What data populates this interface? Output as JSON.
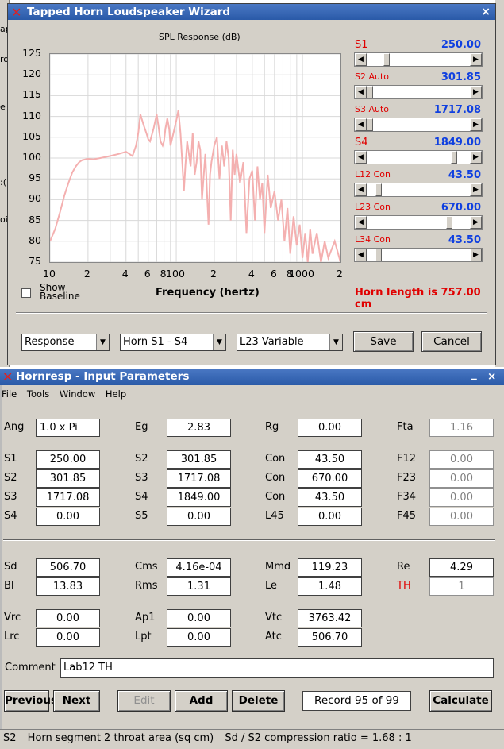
{
  "background": {
    "fragments": [
      "ap",
      "ro",
      "e",
      ":(",
      "oi"
    ]
  },
  "wizard": {
    "title": "Tapped Horn Loudspeaker Wizard",
    "close_icon": "close-icon",
    "chart_title": "SPL Response (dB)",
    "show_baseline_line1": "Show",
    "show_baseline_line2": "Baseline",
    "sliders": [
      {
        "label": "S1",
        "value": "250.00",
        "level": 0.17
      },
      {
        "label": "S2 Auto",
        "value": "301.85",
        "level": 0.0
      },
      {
        "label": "S3 Auto",
        "value": "1717.08",
        "level": 0.0
      },
      {
        "label": "S4",
        "value": "1849.00",
        "level": 0.87
      },
      {
        "label": "L12 Con",
        "value": "43.50",
        "level": 0.09
      },
      {
        "label": "L23 Con",
        "value": "670.00",
        "level": 0.82
      },
      {
        "label": "L34 Con",
        "value": "43.50",
        "level": 0.09
      }
    ],
    "horn_length": "Horn length is 757.00 cm",
    "dropdowns": [
      "Response",
      "Horn S1 - S4",
      "L23 Variable"
    ],
    "save_label": "Save",
    "cancel_label": "Cancel"
  },
  "chart_data": {
    "type": "line",
    "title": "SPL Response (dB)",
    "xlabel": "Frequency (hertz)",
    "ylabel": "",
    "xscale": "log",
    "xlim": [
      10,
      2000
    ],
    "ylim": [
      75,
      125
    ],
    "y_ticks": [
      "125",
      "120",
      "115",
      "110",
      "105",
      "100",
      "95",
      "90",
      "85",
      "80",
      "75"
    ],
    "x_ticks": [
      "10",
      "2",
      "4",
      "6",
      "8",
      "100",
      "2",
      "4",
      "6",
      "8",
      "1000",
      "2"
    ],
    "grid": true,
    "series_color": "#f4b0b0",
    "series": [
      {
        "name": "",
        "x": [
          10,
          11,
          12,
          13,
          14,
          15,
          16,
          17,
          18,
          20,
          22,
          25,
          30,
          35,
          40,
          45,
          48,
          50,
          52,
          55,
          58,
          60,
          62,
          66,
          70,
          72,
          75,
          78,
          80,
          82,
          85,
          88,
          90,
          95,
          100,
          104,
          108,
          112,
          115,
          118,
          122,
          126,
          130,
          135,
          140,
          145,
          150,
          155,
          160,
          165,
          170,
          175,
          180,
          185,
          190,
          200,
          210,
          220,
          230,
          240,
          250,
          260,
          270,
          280,
          290,
          300,
          320,
          340,
          360,
          380,
          400,
          420,
          440,
          460,
          480,
          500,
          530,
          560,
          600,
          640,
          680,
          720,
          760,
          800,
          850,
          900,
          950,
          1000,
          1050,
          1100,
          1150,
          1200,
          1300,
          1400,
          1500,
          1600,
          1800,
          2000
        ],
        "y": [
          80,
          83,
          87,
          91,
          94,
          96.5,
          98,
          99,
          99.5,
          99.8,
          99.7,
          100,
          100.5,
          101,
          101.5,
          100.5,
          103,
          106,
          110.5,
          108,
          106,
          104.5,
          104,
          107,
          110.5,
          108,
          104,
          103,
          104,
          107,
          109.5,
          107,
          103,
          106,
          109,
          111.5,
          106,
          98,
          92,
          98,
          104,
          101,
          98,
          106,
          96,
          99,
          104,
          102,
          90,
          96,
          101,
          92,
          84,
          96,
          99,
          103,
          105,
          95,
          103,
          98,
          104,
          100,
          85,
          102,
          96,
          101,
          94,
          99,
          82,
          95,
          97,
          85,
          98,
          90,
          94,
          82,
          96,
          88,
          92,
          85,
          90,
          80,
          88,
          77,
          86,
          79,
          84,
          76,
          82,
          75,
          83,
          77,
          82,
          75,
          80,
          76,
          80,
          75
        ]
      }
    ]
  },
  "hornresp": {
    "title": "Hornresp - Input Parameters",
    "minimize_icon": "minimize-icon",
    "close_icon": "close-icon",
    "menu": [
      "File",
      "Tools",
      "Window",
      "Help"
    ],
    "rows": [
      {
        "c1": [
          "Ang",
          "1.0 x Pi"
        ],
        "c2": [
          "Eg",
          "2.83"
        ],
        "c3": [
          "Rg",
          "0.00"
        ],
        "c4": [
          "Fta",
          "1.16"
        ]
      },
      {
        "c1": [
          "S1",
          "250.00"
        ],
        "c2": [
          "S2",
          "301.85"
        ],
        "c3": [
          "Con",
          "43.50"
        ],
        "c4": [
          "F12",
          "0.00"
        ]
      },
      {
        "c1": [
          "S2",
          "301.85"
        ],
        "c2": [
          "S3",
          "1717.08"
        ],
        "c3": [
          "Con",
          "670.00"
        ],
        "c4": [
          "F23",
          "0.00"
        ]
      },
      {
        "c1": [
          "S3",
          "1717.08"
        ],
        "c2": [
          "S4",
          "1849.00"
        ],
        "c3": [
          "Con",
          "43.50"
        ],
        "c4": [
          "F34",
          "0.00"
        ]
      },
      {
        "c1": [
          "S4",
          "0.00"
        ],
        "c2": [
          "S5",
          "0.00"
        ],
        "c3": [
          "L45",
          "0.00"
        ],
        "c4": [
          "F45",
          "0.00"
        ]
      },
      {
        "c1": [
          "Sd",
          "506.70"
        ],
        "c2": [
          "Cms",
          "4.16e-04"
        ],
        "c3": [
          "Mmd",
          "119.23"
        ],
        "c4": [
          "Re",
          "4.29"
        ]
      },
      {
        "c1": [
          "Bl",
          "13.83"
        ],
        "c2": [
          "Rms",
          "1.31"
        ],
        "c3": [
          "Le",
          "1.48"
        ],
        "c4": [
          "TH",
          "1"
        ]
      },
      {
        "c1": [
          "Vrc",
          "0.00"
        ],
        "c2": [
          "Ap1",
          "0.00"
        ],
        "c3": [
          "Vtc",
          "3763.42"
        ],
        "c4": [
          "",
          ""
        ]
      },
      {
        "c1": [
          "Lrc",
          "0.00"
        ],
        "c2": [
          "Lpt",
          "0.00"
        ],
        "c3": [
          "Atc",
          "506.70"
        ],
        "c4": [
          "",
          ""
        ]
      }
    ],
    "comment_label": "Comment",
    "comment_value": "Lab12 TH",
    "buttons": {
      "previous": "Previous",
      "next": "Next",
      "edit": "Edit",
      "add": "Add",
      "delete": "Delete",
      "calculate": "Calculate"
    },
    "record": "Record 95 of 99",
    "status": {
      "field": "S2",
      "description": "Horn segment 2 throat area  (sq cm)",
      "ratio": "Sd / S2 compression ratio = 1.68 : 1"
    }
  }
}
